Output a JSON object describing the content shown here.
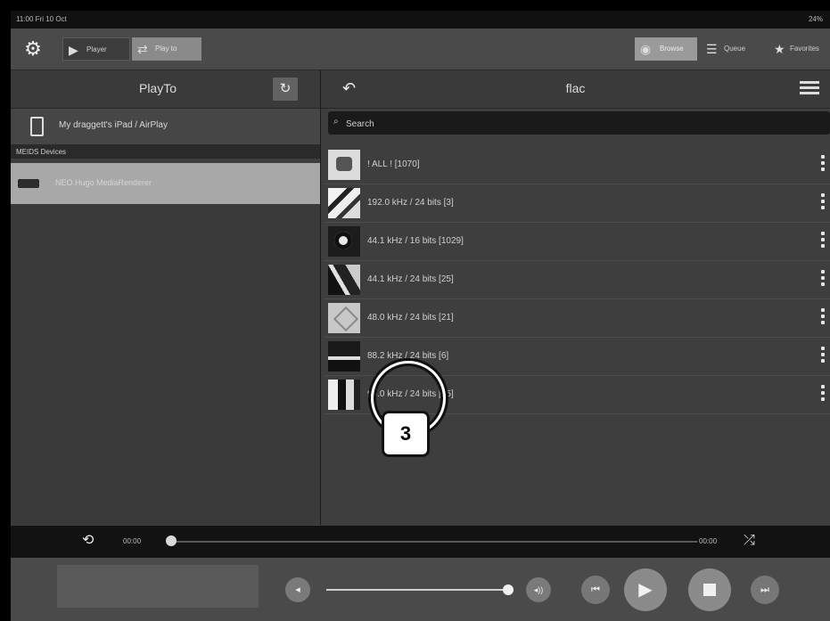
{
  "status": {
    "left": "11:00 Fri 10 Oct",
    "right": "24%"
  },
  "toolbar": {
    "player_label": "Player",
    "playto_label": "Play to",
    "browse_label": "Browse",
    "queue_label": "Queue",
    "favorites_label": "Favorites"
  },
  "left_panel": {
    "title": "PlayTo",
    "current_device": "My draggett's iPad / AirPlay",
    "section_header": "MEIDS Devices",
    "devices": [
      {
        "label": "NEO Hugo MediaRenderer"
      }
    ]
  },
  "right_panel": {
    "title": "flac",
    "search_placeholder": "Search",
    "items": [
      {
        "label": "! ALL ! [1070]"
      },
      {
        "label": "192.0 kHz / 24 bits [3]"
      },
      {
        "label": "44.1 kHz / 16 bits [1029]"
      },
      {
        "label": "44.1 kHz / 24 bits [25]"
      },
      {
        "label": "48.0 kHz / 24 bits [21]"
      },
      {
        "label": "88.2 kHz / 24 bits [6]"
      },
      {
        "label": "96.0 kHz / 24 bits [35]"
      }
    ]
  },
  "callout": {
    "number": "3"
  },
  "playback": {
    "elapsed": "00:00",
    "remaining": "00:00",
    "progress": 0.0,
    "volume": 1.0
  },
  "icons": [
    "gear-icon",
    "play-icon",
    "playto-icon",
    "refresh-icon",
    "back-icon",
    "list-view-icon",
    "search-icon",
    "ipad-icon",
    "renderer-icon",
    "kebab-icon",
    "repeat-icon",
    "shuffle-icon",
    "volume-down-icon",
    "volume-up-icon",
    "previous-icon",
    "play-icon",
    "stop-icon",
    "next-icon"
  ]
}
